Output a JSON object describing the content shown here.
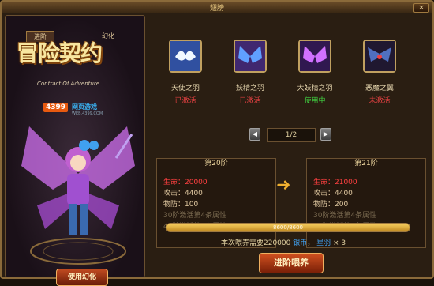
{
  "window": {
    "title": "翅膀",
    "close_label": "×"
  },
  "tabs": [
    {
      "label": "进阶"
    },
    {
      "label": "幻化"
    }
  ],
  "logo": {
    "title": "冒险契约",
    "subtitle": "Contract Of Adventure"
  },
  "badge": {
    "number": "4399",
    "text": "网页游戏",
    "url": "WEB.4399.COM"
  },
  "use_button": "使用幻化",
  "wings": [
    {
      "name": "天使之羽",
      "status": "已激活",
      "status_color": "#e04040",
      "icon": "white-wing-icon"
    },
    {
      "name": "妖精之羽",
      "status": "已激活",
      "status_color": "#e04040",
      "icon": "blue-fairy-wing-icon"
    },
    {
      "name": "大妖精之羽",
      "status": "使用中",
      "status_color": "#40d040",
      "icon": "purple-fairy-wing-icon"
    },
    {
      "name": "恶魔之翼",
      "status": "未激活",
      "status_color": "#e04040",
      "icon": "demon-wing-icon"
    }
  ],
  "pager": {
    "prev": "◀",
    "next": "▶",
    "page": "1/2"
  },
  "current_stage": {
    "title": "第20阶",
    "stats": [
      {
        "label": "生命：20000",
        "color": "#ff4040"
      },
      {
        "label": "攻击：4400",
        "color": "#e0c8a0"
      },
      {
        "label": "物防：100",
        "color": "#e0c8a0"
      },
      {
        "label": "30阶激活第4条属性",
        "color": "#7a6a50"
      },
      {
        "label": "40阶激活第5条属性",
        "color": "#7a6a50"
      }
    ]
  },
  "next_stage": {
    "title": "第21阶",
    "stats": [
      {
        "label": "生命：21000",
        "color": "#ff4040"
      },
      {
        "label": "攻击：4400",
        "color": "#e0c8a0"
      },
      {
        "label": "物防：200",
        "color": "#e0c8a0"
      },
      {
        "label": "30阶激活第4条属性",
        "color": "#7a6a50"
      },
      {
        "label": "40阶激活第5条属性",
        "color": "#7a6a50"
      }
    ]
  },
  "progress": {
    "text": "8600/8600",
    "fraction": 1.0
  },
  "cost": {
    "prefix": "本次喂养需要220000",
    "currency1": "银币",
    "sep": "，",
    "currency2": "星羽",
    "mult": "× 3"
  },
  "advance_button": "进阶喂养"
}
